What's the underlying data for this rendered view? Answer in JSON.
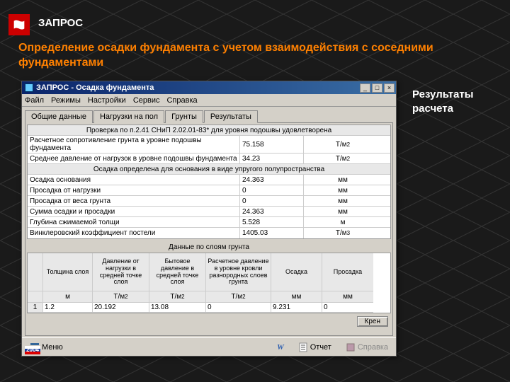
{
  "slide": {
    "header": "ЗАПРОС",
    "subtitle": "Определение осадки фундамента с учетом взаимодействия с соседними фундаментами",
    "side_label": "Результаты расчета"
  },
  "window": {
    "title": "ЗАПРОС - Осадка фундамента",
    "menu": [
      "Файл",
      "Режимы",
      "Настройки",
      "Сервис",
      "Справка"
    ],
    "tabs": [
      "Общие данные",
      "Нагрузки на пол",
      "Грунты",
      "Результаты"
    ],
    "active_tab": 3,
    "results_top_row": "Проверка по п.2.41 СНиП 2.02.01-83* для уровня подошвы удовлетворена",
    "rows_a": [
      {
        "label": "Расчетное сопротивление грунта в уровне подошвы фундамента",
        "val": "75.158",
        "unit_html": "Т/м²"
      },
      {
        "label": "Среднее давление от нагрузок в уровне подошвы фундамента",
        "val": "34.23",
        "unit_html": "Т/м²"
      }
    ],
    "section_b": "Осадка определена для основания в виде упругого полупространства",
    "rows_b": [
      {
        "label": "Осадка основания",
        "val": "24.363",
        "unit": "мм"
      },
      {
        "label": "Просадка от нагрузки",
        "val": "0",
        "unit": "мм"
      },
      {
        "label": "Просадка от веса грунта",
        "val": "0",
        "unit": "мм"
      },
      {
        "label": "Сумма осадки и просадки",
        "val": "24.363",
        "unit": "мм"
      },
      {
        "label": "Глубина сжимаемой толщи",
        "val": "5.528",
        "unit": "м"
      },
      {
        "label": "Винклеровский коэффициент постели",
        "val": "1405.03",
        "unit_html": "Т/м³"
      }
    ],
    "grid2": {
      "caption": "Данные по слоям грунта",
      "headers": [
        "",
        "Толщина слоя",
        "Давление от нагрузки в средней точке слоя",
        "Бытовое давление в средней точке слоя",
        "Расчетное давление в уровне кровли разнородных слоев грунта",
        "Осадка",
        "Просадка"
      ],
      "units": [
        "",
        "м",
        "Т/м²",
        "Т/м²",
        "Т/м²",
        "мм",
        "мм"
      ],
      "row1": [
        "1",
        "1.2",
        "20.192",
        "13.08",
        "0",
        "9.231",
        "0"
      ]
    },
    "kren": "Крен",
    "toolbar": {
      "menu": "Меню",
      "otchet": "Отчет",
      "spravka": "Справка",
      "year": "2004"
    }
  }
}
